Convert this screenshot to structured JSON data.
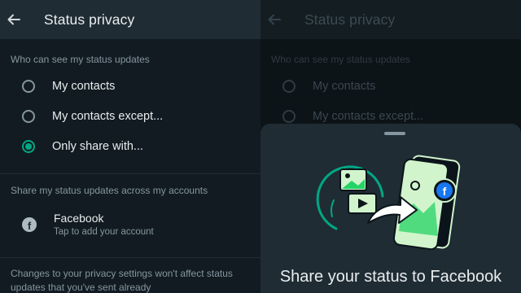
{
  "header": {
    "title": "Status privacy"
  },
  "visibility": {
    "section_label": "Who can see my status updates",
    "options": [
      {
        "label": "My contacts",
        "selected": false
      },
      {
        "label": "My contacts except...",
        "selected": false
      },
      {
        "label": "Only share with...",
        "selected": true
      }
    ]
  },
  "share": {
    "section_label": "Share my status updates across my accounts",
    "account": {
      "name": "Facebook",
      "subtitle": "Tap to add your account",
      "icon": "facebook-icon"
    }
  },
  "note": "Changes to your privacy settings won't affect status updates that you've sent already",
  "sheet": {
    "title": "Share your status to Facebook"
  },
  "colors": {
    "accent": "#00a884",
    "background": "#111b21",
    "appbar": "#1f2c34",
    "secondary_text": "#8696a0"
  }
}
